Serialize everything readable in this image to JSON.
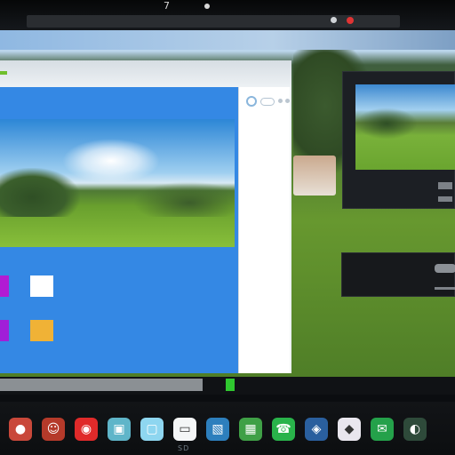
{
  "colors": {
    "desktop_sky": "#9ec7ea",
    "content_blue": "#3488e4",
    "accent_green": "#6fbf2c",
    "close_red": "#e03434",
    "scroll_green": "#2fc82f"
  },
  "top_bar": {
    "glyph": "7"
  },
  "main_window": {
    "tiles": [
      {
        "name": "tile-purple-1",
        "color": "#b21bd3"
      },
      {
        "name": "tile-white",
        "color": "#ffffff"
      },
      {
        "name": "tile-purple-2",
        "color": "#a11fd8"
      },
      {
        "name": "tile-orange",
        "color": "#f0b236"
      }
    ]
  },
  "dock": {
    "items": [
      {
        "name": "red-app-icon",
        "icon": "red-circle",
        "color": "#c9483a",
        "glyph": "●"
      },
      {
        "name": "mascot-icon",
        "icon": "mascot",
        "color": "#b53a2a",
        "glyph": "☺"
      },
      {
        "name": "red-shield-icon",
        "icon": "shield",
        "color": "#e02a2a",
        "glyph": "◉"
      },
      {
        "name": "photo-icon",
        "icon": "photo",
        "color": "#5fb5c9",
        "glyph": "▣"
      },
      {
        "name": "chat-icon",
        "icon": "chat",
        "color": "#8ed6f0",
        "glyph": "▢"
      },
      {
        "name": "document-icon",
        "icon": "document",
        "color": "#f4f6f7",
        "glyph": "▭"
      },
      {
        "name": "picture-icon",
        "icon": "picture",
        "color": "#2d7fbd",
        "glyph": "▧"
      },
      {
        "name": "spreadsheet-icon",
        "icon": "spreadsheet",
        "color": "#3fa046",
        "glyph": "▦"
      },
      {
        "name": "phone-icon",
        "icon": "phone",
        "color": "#29b34a",
        "glyph": "☎"
      },
      {
        "name": "browser-icon",
        "icon": "browser",
        "color": "#2a5f9e",
        "glyph": "◈"
      },
      {
        "name": "image-viewer-icon",
        "icon": "image-viewer",
        "color": "#e9e6ee",
        "glyph": "◆"
      },
      {
        "name": "messages-icon",
        "icon": "messages",
        "color": "#24a14a",
        "glyph": "✉"
      },
      {
        "name": "globe-icon",
        "icon": "globe",
        "color": "#2e4a3a",
        "glyph": "◐"
      }
    ],
    "footer": "SD"
  }
}
